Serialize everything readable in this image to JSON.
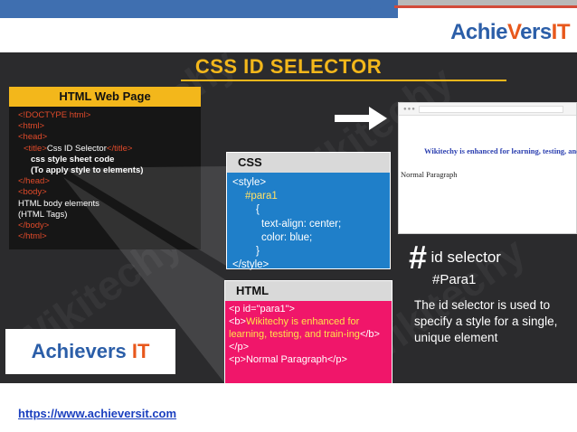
{
  "brand": {
    "logo_text_a": "Achie",
    "logo_text_b": "ers",
    "logo_mark": "V",
    "logo_it": "IT",
    "box_name": "Achievers ",
    "box_it": "IT",
    "colors": {
      "blue": "#2b5ea8",
      "orange": "#e8581c",
      "gold": "#f3b71b",
      "pink": "#f0166a",
      "css_blue": "#1f7fc9"
    }
  },
  "slide": {
    "title": "CSS ID SELECTOR",
    "webpage": {
      "header": "HTML Web Page",
      "lines": [
        "<!DOCTYPE html>",
        "<html>",
        "<head>",
        "<title>",
        "Css ID Selector",
        "</title>",
        "css style sheet code",
        "(To apply style to elements)",
        "</head>",
        "<body>",
        "HTML body elements",
        "(HTML Tags)",
        "</body>",
        "</html>"
      ]
    },
    "browser": {
      "blue_text": "Wikitechy is enhanced for learning, testing, and training",
      "normal_text": "Normal Paragraph"
    },
    "css_box": {
      "header": "CSS",
      "lines": [
        "<style>",
        "#para1",
        "{",
        "text-align: center;",
        "color: blue;",
        "}",
        "</style>"
      ]
    },
    "html_box": {
      "header": "HTML",
      "lines": [
        "<p id=\"para1\">",
        "<b>",
        "Wikitechy is enhanced for learning, testing, and train-ing",
        "</b>",
        "</p>",
        "<p>Normal Paragraph</p>"
      ]
    },
    "id_selector": {
      "hash": "#",
      "label": "id selector",
      "example": "#Para1",
      "description": "The id selector is used to specify a style for a single, unique element"
    }
  },
  "footer": {
    "link": "https://www.achieversit.com"
  }
}
